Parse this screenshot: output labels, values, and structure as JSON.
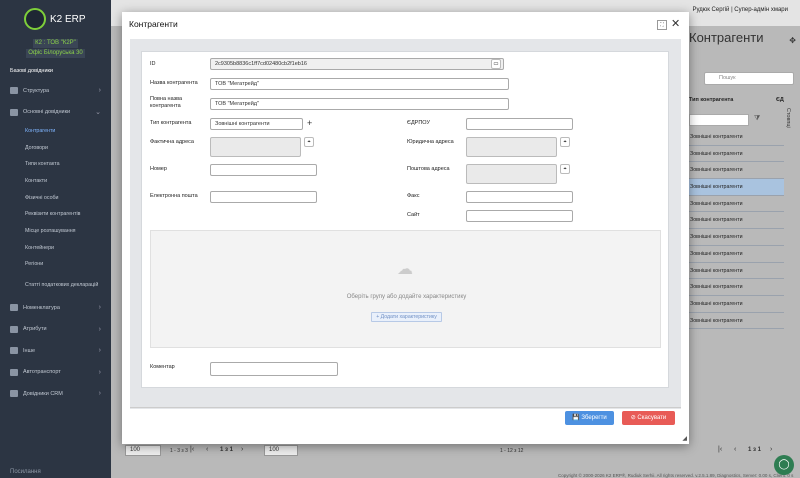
{
  "app": {
    "name": "K2 ERP",
    "company_line1": "К2 : ТОВ \"К2Р\"",
    "company_line2": "Офіс Білоруська 30"
  },
  "sidebar": {
    "section": "Базові довідники",
    "items": [
      {
        "label": "Структура"
      },
      {
        "label": "Основні довідники"
      }
    ],
    "subitems": [
      "Контрагенти",
      "Договори",
      "Типи контакта",
      "Контакти",
      "Фізичні особи",
      "Реквізити контрагентів",
      "Місце розташування",
      "Контейнери",
      "Регіони",
      "Статті податкових декларацій"
    ],
    "bottom_items": [
      {
        "label": "Номенклатура"
      },
      {
        "label": "Атрибути"
      },
      {
        "label": "Інше"
      },
      {
        "label": "Автотранспорт"
      },
      {
        "label": "Довідники CRM"
      }
    ],
    "footer": "Посилання"
  },
  "topbar": {
    "user": "Рудюк Сергій | Супер-адмін хмари"
  },
  "background": {
    "title": "Контрагенти",
    "search_placeholder": "Пошук",
    "col_type": "Тип контрагента",
    "col_ed": "ЄД",
    "columns_tab": "Стовпці",
    "rows": [
      "Зовнішні контрагенти",
      "Зовнішні контрагенти",
      "Зовнішні контрагенти",
      "Зовнішні контрагенти",
      "Зовнішні контрагенти",
      "Зовнішні контрагенти",
      "Зовнішні контрагенти",
      "Зовнішні контрагенти",
      "Зовнішні контрагенти",
      "Зовнішні контрагенти",
      "Зовнішні контрагенти",
      "Зовнішні контрагенти"
    ],
    "selected_row": 3,
    "pager_left": {
      "size": "100",
      "range": "1 - 3 з 3",
      "page": "1 з 1"
    },
    "pager_mid": {
      "size": "100",
      "range": "1 - 12 з 12"
    },
    "pager_right": {
      "page": "1 з 1"
    },
    "copyright": "Copyright © 2000-2026 K2 ERP®, Rudiuk Serhii. All rights reserved. v.2.5.1.89, Diagnostics, Server: 0.00 s, Client: 0 s"
  },
  "dialog": {
    "title": "Контрагенти",
    "labels": {
      "id": "ID",
      "name": "Назва контрагента",
      "full_name": "Повна назва контрагента",
      "type": "Тип контрагента",
      "edrpou": "ЄДРПОУ",
      "fact_address": "Фактична адреса",
      "legal_address": "Юридична адреса",
      "phone": "Номер",
      "post_address": "Поштова адреса",
      "email": "Електронна пошта",
      "fax": "Факс",
      "site": "Сайт",
      "comment": "Коментар"
    },
    "values": {
      "id": "2c9305b8836c1ff7cd02480cb2f1eb16",
      "name": "ТОВ \"Мегатрейд\"",
      "full_name": "ТОВ \"Мегатрейд\"",
      "type": "Зовнішні контрагенти",
      "edrpou": "",
      "phone": "",
      "email": "",
      "fax": "",
      "site": "",
      "comment": ""
    },
    "characteristics_empty": "Оберіть групу або додайте характеристику",
    "add_characteristic": "+ Додати характеристику",
    "save": "Зберегти",
    "cancel": "Скасувати"
  },
  "colors": {
    "sidebar_bg": "#2c3543",
    "save": "#4d91e1",
    "cancel": "#e85b56",
    "accent_green": "#7ecf3a"
  }
}
